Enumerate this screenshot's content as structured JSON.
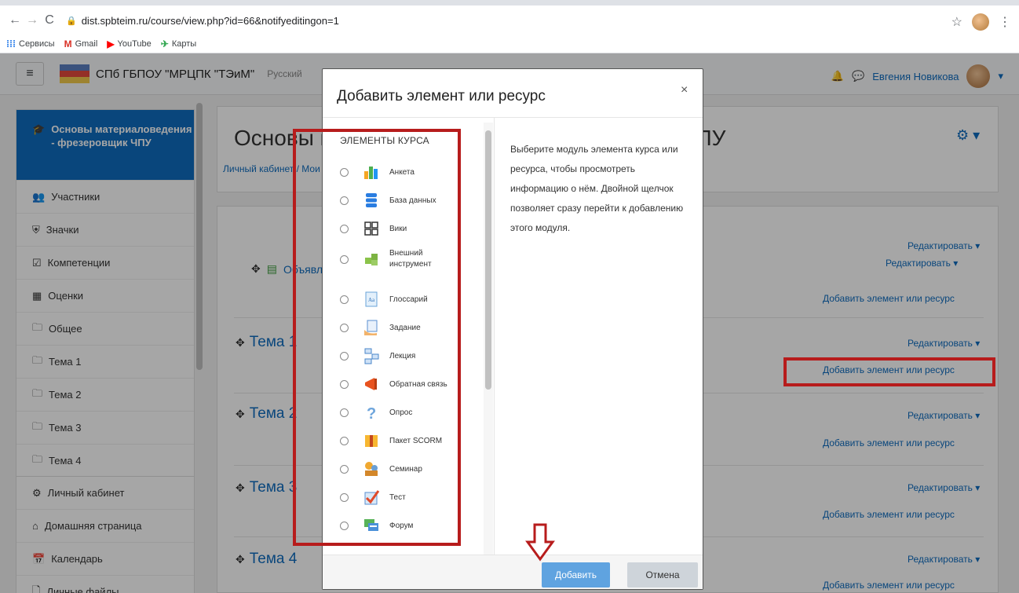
{
  "browser": {
    "url": "dist.spbteim.ru/course/view.php?id=66&notifyeditingon=1",
    "bookmarks": [
      "Сервисы",
      "Gmail",
      "YouTube",
      "Карты"
    ]
  },
  "navbar": {
    "site_name": "СПб ГБПОУ \"МРЦПК \"ТЭиМ\"",
    "lang": "Русский",
    "user_name": "Евгения Новикова"
  },
  "drawer": {
    "course": "Основы материаловедения - фрезеровщик ЧПУ",
    "items": [
      "Участники",
      "Значки",
      "Компетенции",
      "Оценки",
      "Общее",
      "Тема 1",
      "Тема 2",
      "Тема 3",
      "Тема 4"
    ],
    "items2": [
      "Личный кабинет",
      "Домашняя страница",
      "Календарь",
      "Личные файлы"
    ]
  },
  "main": {
    "course_title": "Основы материаловедения - фрезеровщик ЧПУ",
    "breadcrumb": "Личный кабинет / Мои курсы",
    "forum_label": "Объявления",
    "edit": "Редактировать ▾",
    "edit_user": "Редактировать ▾",
    "add": "Добавить элемент или ресурс",
    "sections": [
      "Тема 1",
      "Тема 2",
      "Тема 3",
      "Тема 4"
    ]
  },
  "modal": {
    "title": "Добавить элемент или ресурс",
    "close": "×",
    "list_header": "ЭЛЕМЕНТЫ КУРСА",
    "options": [
      {
        "label": "Анкета",
        "icon": "survey-icon"
      },
      {
        "label": "База данных",
        "icon": "database-icon"
      },
      {
        "label": "Вики",
        "icon": "wiki-icon"
      },
      {
        "label": "Внешний инструмент",
        "icon": "external-tool-icon"
      },
      {
        "label": "Глоссарий",
        "icon": "glossary-icon"
      },
      {
        "label": "Задание",
        "icon": "assignment-icon"
      },
      {
        "label": "Лекция",
        "icon": "lesson-icon"
      },
      {
        "label": "Обратная связь",
        "icon": "feedback-icon"
      },
      {
        "label": "Опрос",
        "icon": "choice-icon"
      },
      {
        "label": "Пакет SCORM",
        "icon": "scorm-icon"
      },
      {
        "label": "Семинар",
        "icon": "workshop-icon"
      },
      {
        "label": "Тест",
        "icon": "quiz-icon"
      },
      {
        "label": "Форум",
        "icon": "forum-icon"
      }
    ],
    "description": "Выберите модуль элемента курса или ресурса, чтобы просмотреть информацию о нём. Двойной щелчок позволяет сразу перейти к добавлению этого модуля.",
    "add_button": "Добавить",
    "cancel_button": "Отмена"
  }
}
